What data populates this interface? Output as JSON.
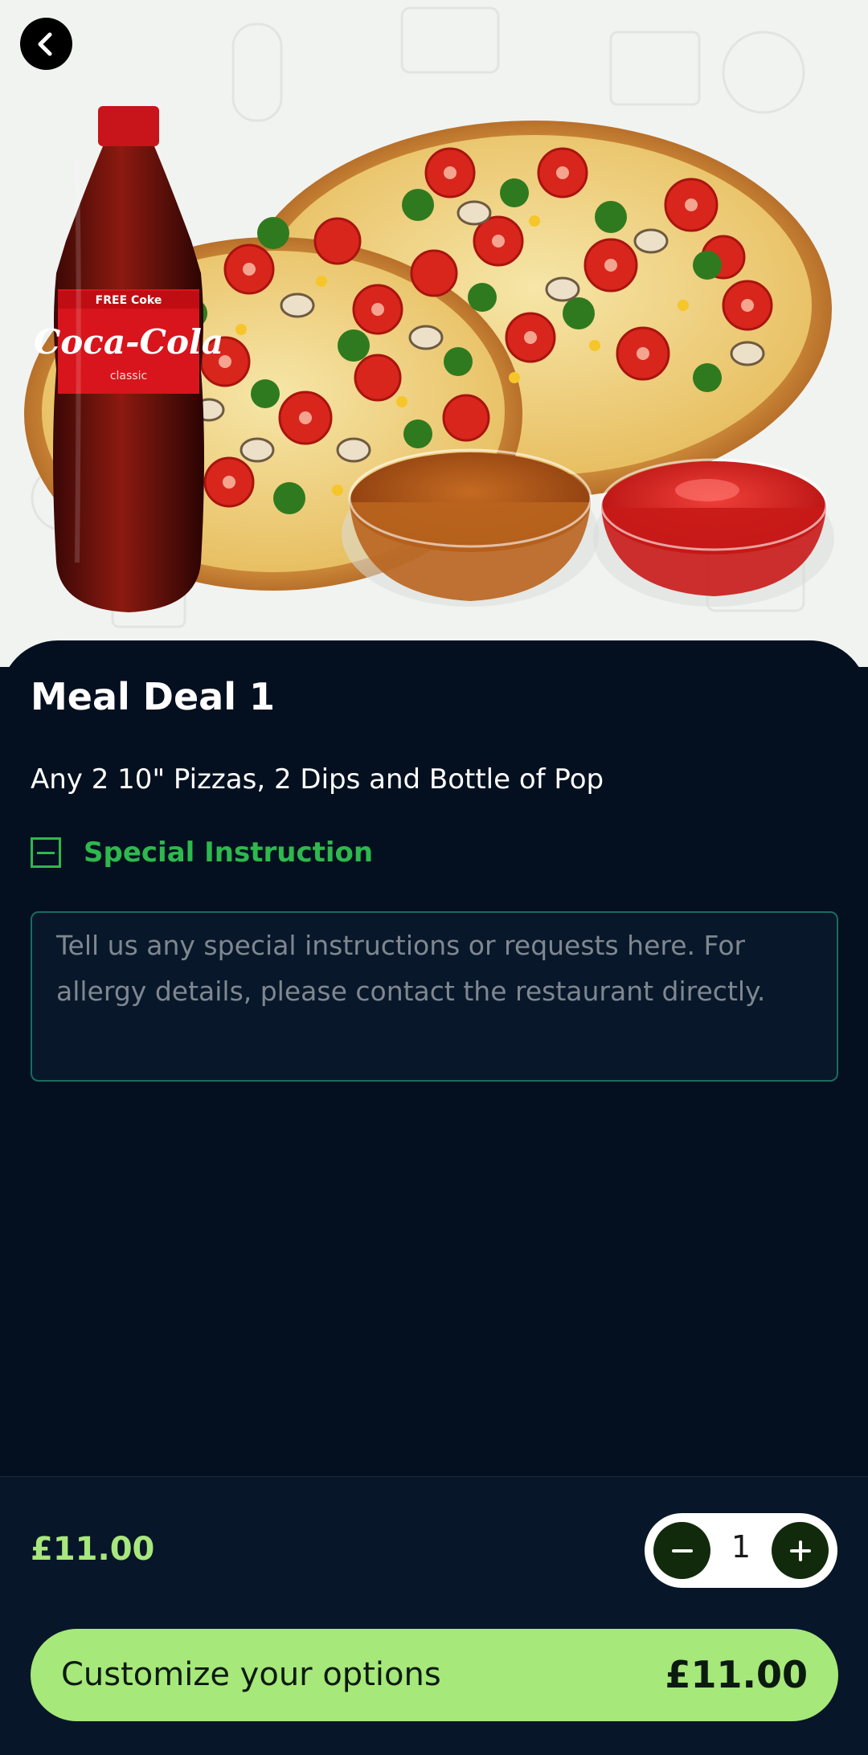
{
  "nav": {
    "back_icon": "chevron-left-icon"
  },
  "hero": {
    "bottle_label": "Coca-Cola",
    "bottle_sub": "classic"
  },
  "item": {
    "title": "Meal Deal 1",
    "description": "Any 2 10\" Pizzas, 2 Dips and Bottle of Pop"
  },
  "special_instruction": {
    "label": "Special Instruction",
    "toggle_icon": "minus-square-icon",
    "placeholder": "Tell us any special instructions or requests here. For allergy details, please contact the restaurant directly."
  },
  "footer": {
    "price": "£11.00",
    "quantity": "1",
    "minus_icon": "minus-icon",
    "plus_icon": "plus-icon",
    "cta_label": "Customize your options",
    "cta_price": "£11.00"
  },
  "colors": {
    "background": "#04101f",
    "accent_green": "#2eb84e",
    "price_green": "#a8e77d",
    "cta_green": "#a6e879"
  }
}
